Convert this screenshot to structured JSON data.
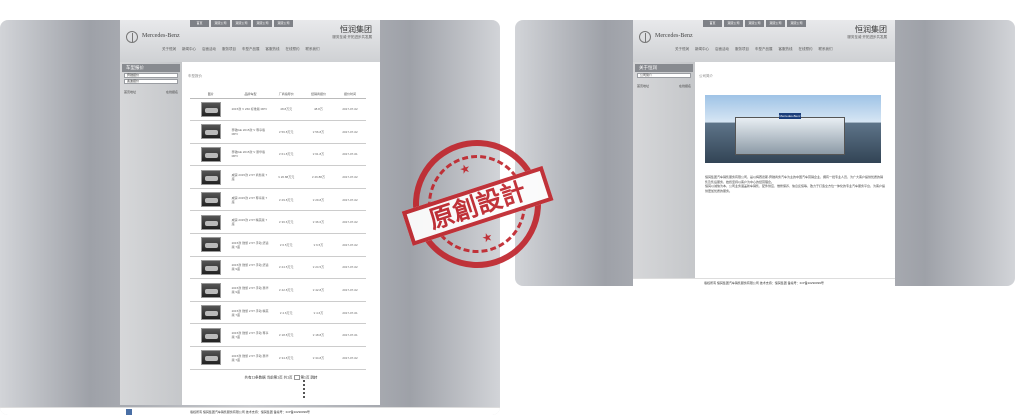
{
  "header": {
    "company": "恒润集团",
    "slogan": "服务至诚·开拓进步共发展",
    "brand": "Mercedes-Benz",
    "top_nav": [
      "首页",
      "潮流公司",
      "潮流公司",
      "潮流公司",
      "潮流公司"
    ],
    "sub_nav": [
      "关于恒润",
      "新闻中心",
      "店面活动",
      "服务项目",
      "车型产品展",
      "客服热线",
      "在线预约",
      "联系我们"
    ]
  },
  "left_page": {
    "sidebar_title": "车型报价",
    "sidebar_items": [
      "奔驰报价",
      "奥迪报价"
    ],
    "sidebar_links": [
      "首页地址",
      "在线报名"
    ],
    "breadcrumb": "车型报价",
    "table_headers": [
      "图片",
      "品牌车型",
      "厂商指导价",
      "经销商报价",
      "报价时间"
    ],
    "rows": [
      {
        "name": "2015款 V 260 标准版 MPV",
        "msrp": "48.8万元",
        "dealer": "48.8万",
        "date": "2017-07-02"
      },
      {
        "name": "奔驰GE 2015款 V 尊享版 MPV",
        "msrp": "¥ 56.8万元",
        "dealer": "¥ 56.8万",
        "date": "2017-07-02"
      },
      {
        "name": "奔驰GE 2015款 V 豪华版 MPV",
        "msrp": "¥ 61.8万元",
        "dealer": "¥ 61.8万",
        "date": "2017-07-01"
      },
      {
        "name": "威霆 2015款 2.5T 商务版 7座",
        "msrp": "¥ 26.88万元",
        "dealer": "¥ 26.88万",
        "date": "2017-07-02"
      },
      {
        "name": "威霆 2015款 2.5T 尊享版 7座",
        "msrp": "¥ 29.8万元",
        "dealer": "¥ 29.8万",
        "date": "2017-07-02"
      },
      {
        "name": "威霆 2015款 2.5T 精英版 7座",
        "msrp": "¥ 36.6万元",
        "dealer": "¥ 36.6万",
        "date": "2017-07-02"
      },
      {
        "name": "2015款 微旅 2.5T 手动 舒适版 7座",
        "msrp": "¥ 6.5万元",
        "dealer": "¥ 6.5万",
        "date": "2017-07-02"
      },
      {
        "name": "2015款 微旅 2.5T 手动 舒适版 9座",
        "msrp": "¥ 24.5万元",
        "dealer": "¥ 24.5万",
        "date": "2017-07-02"
      },
      {
        "name": "2015款 微旅 2.5T 手动 豪华版 9座",
        "msrp": "¥ 42.8万元",
        "dealer": "¥ 42.8万",
        "date": "2017-07-02"
      },
      {
        "name": "2015款 微旅 2.5T 手动 精英版 7座",
        "msrp": "¥ 4.6万元",
        "dealer": "¥ 4.6万",
        "date": "2017-07-01"
      },
      {
        "name": "2015款 微旅 2.5T 手动 尊享版 7座",
        "msrp": "¥ 18.8万元",
        "dealer": "¥ 18.8万",
        "date": "2017-07-01"
      },
      {
        "name": "2015款 微旅 2.5T 手动 豪华版 7座",
        "msrp": "¥ 34.8万元",
        "dealer": "¥ 34.8万",
        "date": "2017-07-02"
      }
    ],
    "pager": "共有11条数据   当前第1页   共1页",
    "pager_next": "第1页",
    "pager_last": "跳转"
  },
  "right_page": {
    "sidebar_title": "关于恒润",
    "sidebar_items": [
      "公司简介"
    ],
    "sidebar_links": [
      "首页地址",
      "在线报名"
    ],
    "breadcrumb": "公司简介",
    "showroom_sign": "Mercedes-Benz",
    "intro_1": "恒润集团汽车销售服务有限公司，是以梅赛德斯-奔驰商务汽车为主的中国汽车营销企业，拥有一批专业人员，为广大客户提供优质的销售及售后服务，始终坚持以客户为中心的经营理念。",
    "intro_2": "恒润以诚信为本，公司业务涵盖新车销售、配件供应、维修保养、信息反馈等，致力于打造全方位一体化的专业汽车服务平台，为客户提供更加优质的服务。"
  },
  "footer": "版权所有 恒润集团汽车销售服务有限公司 技术支持：恒润集团    备案号：ICP备10290099号",
  "stamp_text": "原創設計"
}
